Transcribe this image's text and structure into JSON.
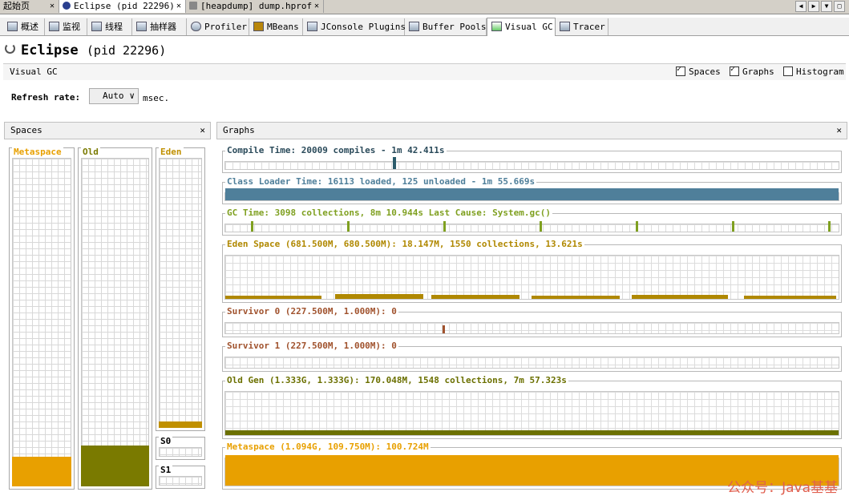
{
  "editor_tabs": [
    {
      "label": "起始页",
      "active": false
    },
    {
      "label": "Eclipse (pid 22296)",
      "active": true
    },
    {
      "label": "[heapdump] dump.hprof",
      "active": false
    }
  ],
  "tool_tabs": [
    {
      "label": "概述",
      "icon": "overview-icon"
    },
    {
      "label": "监视",
      "icon": "monitor-icon"
    },
    {
      "label": "线程",
      "icon": "threads-icon"
    },
    {
      "label": "抽样器",
      "icon": "sampler-icon"
    },
    {
      "label": "Profiler",
      "icon": "profiler-icon"
    },
    {
      "label": "MBeans",
      "icon": "mbeans-icon"
    },
    {
      "label": "JConsole Plugins",
      "icon": "jconsole-icon"
    },
    {
      "label": "Buffer Pools",
      "icon": "buffer-pools-icon"
    },
    {
      "label": "Visual GC",
      "icon": "visual-gc-icon"
    },
    {
      "label": "Tracer",
      "icon": "tracer-icon"
    }
  ],
  "title": {
    "app": "Eclipse",
    "pid": "(pid 22296)"
  },
  "view_bar": {
    "label": "Visual GC",
    "spaces": {
      "label": "Spaces",
      "checked": true
    },
    "graphs": {
      "label": "Graphs",
      "checked": true
    },
    "histogram": {
      "label": "Histogram",
      "checked": false
    }
  },
  "refresh": {
    "label": "Refresh rate:",
    "value": "Auto",
    "unit": "msec."
  },
  "spaces_panel": {
    "title": "Spaces",
    "metaspace": {
      "label": "Metaspace",
      "fill": 0.09,
      "color": "#e8a000"
    },
    "old": {
      "label": "Old",
      "fill": 0.13,
      "color": "#7a7a00"
    },
    "eden": {
      "label": "Eden",
      "fill": 0.03,
      "color": "#c09000"
    },
    "s0": {
      "label": "S0"
    },
    "s1": {
      "label": "S1"
    }
  },
  "graphs_panel": {
    "title": "Graphs",
    "compile": "Compile Time: 20009 compiles - 1m 42.411s",
    "classloader": "Class Loader Time: 16113 loaded, 125 unloaded - 1m 55.669s",
    "gc": "GC Time: 3098 collections, 8m 10.944s  Last Cause: System.gc()",
    "eden": "Eden Space (681.500M, 680.500M): 18.147M, 1550 collections, 13.621s",
    "survivor0": "Survivor 0 (227.500M, 1.000M): 0",
    "survivor1": "Survivor 1 (227.500M, 1.000M): 0",
    "oldgen": "Old Gen (1.333G, 1.333G): 170.048M, 1548 collections, 7m 57.323s",
    "metaspace": "Metaspace (1.094G, 109.750M): 100.724M"
  },
  "colors": {
    "compile": "#2a5a6a",
    "classloader": "#4f7f9a",
    "gc": "#7fa020",
    "eden": "#b08800",
    "survivor": "#a0522d",
    "oldgen": "#6b7000",
    "metaspace": "#e8a000"
  },
  "watermark": "公众号：Java基基"
}
